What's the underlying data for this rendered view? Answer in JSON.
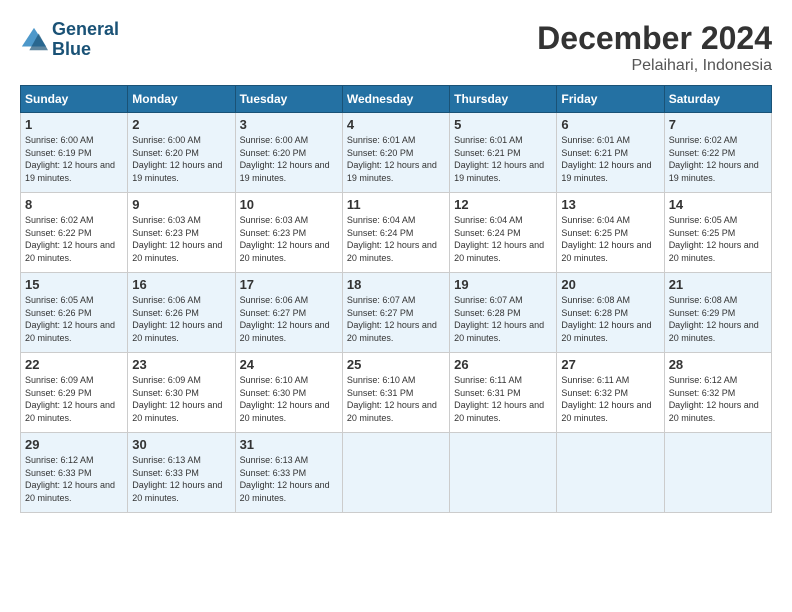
{
  "header": {
    "logo_line1": "General",
    "logo_line2": "Blue",
    "month_title": "December 2024",
    "location": "Pelaihari, Indonesia"
  },
  "weekdays": [
    "Sunday",
    "Monday",
    "Tuesday",
    "Wednesday",
    "Thursday",
    "Friday",
    "Saturday"
  ],
  "weeks": [
    [
      {
        "day": "1",
        "sunrise": "6:00 AM",
        "sunset": "6:19 PM",
        "daylight": "12 hours and 19 minutes."
      },
      {
        "day": "2",
        "sunrise": "6:00 AM",
        "sunset": "6:20 PM",
        "daylight": "12 hours and 19 minutes."
      },
      {
        "day": "3",
        "sunrise": "6:00 AM",
        "sunset": "6:20 PM",
        "daylight": "12 hours and 19 minutes."
      },
      {
        "day": "4",
        "sunrise": "6:01 AM",
        "sunset": "6:20 PM",
        "daylight": "12 hours and 19 minutes."
      },
      {
        "day": "5",
        "sunrise": "6:01 AM",
        "sunset": "6:21 PM",
        "daylight": "12 hours and 19 minutes."
      },
      {
        "day": "6",
        "sunrise": "6:01 AM",
        "sunset": "6:21 PM",
        "daylight": "12 hours and 19 minutes."
      },
      {
        "day": "7",
        "sunrise": "6:02 AM",
        "sunset": "6:22 PM",
        "daylight": "12 hours and 19 minutes."
      }
    ],
    [
      {
        "day": "8",
        "sunrise": "6:02 AM",
        "sunset": "6:22 PM",
        "daylight": "12 hours and 20 minutes."
      },
      {
        "day": "9",
        "sunrise": "6:03 AM",
        "sunset": "6:23 PM",
        "daylight": "12 hours and 20 minutes."
      },
      {
        "day": "10",
        "sunrise": "6:03 AM",
        "sunset": "6:23 PM",
        "daylight": "12 hours and 20 minutes."
      },
      {
        "day": "11",
        "sunrise": "6:04 AM",
        "sunset": "6:24 PM",
        "daylight": "12 hours and 20 minutes."
      },
      {
        "day": "12",
        "sunrise": "6:04 AM",
        "sunset": "6:24 PM",
        "daylight": "12 hours and 20 minutes."
      },
      {
        "day": "13",
        "sunrise": "6:04 AM",
        "sunset": "6:25 PM",
        "daylight": "12 hours and 20 minutes."
      },
      {
        "day": "14",
        "sunrise": "6:05 AM",
        "sunset": "6:25 PM",
        "daylight": "12 hours and 20 minutes."
      }
    ],
    [
      {
        "day": "15",
        "sunrise": "6:05 AM",
        "sunset": "6:26 PM",
        "daylight": "12 hours and 20 minutes."
      },
      {
        "day": "16",
        "sunrise": "6:06 AM",
        "sunset": "6:26 PM",
        "daylight": "12 hours and 20 minutes."
      },
      {
        "day": "17",
        "sunrise": "6:06 AM",
        "sunset": "6:27 PM",
        "daylight": "12 hours and 20 minutes."
      },
      {
        "day": "18",
        "sunrise": "6:07 AM",
        "sunset": "6:27 PM",
        "daylight": "12 hours and 20 minutes."
      },
      {
        "day": "19",
        "sunrise": "6:07 AM",
        "sunset": "6:28 PM",
        "daylight": "12 hours and 20 minutes."
      },
      {
        "day": "20",
        "sunrise": "6:08 AM",
        "sunset": "6:28 PM",
        "daylight": "12 hours and 20 minutes."
      },
      {
        "day": "21",
        "sunrise": "6:08 AM",
        "sunset": "6:29 PM",
        "daylight": "12 hours and 20 minutes."
      }
    ],
    [
      {
        "day": "22",
        "sunrise": "6:09 AM",
        "sunset": "6:29 PM",
        "daylight": "12 hours and 20 minutes."
      },
      {
        "day": "23",
        "sunrise": "6:09 AM",
        "sunset": "6:30 PM",
        "daylight": "12 hours and 20 minutes."
      },
      {
        "day": "24",
        "sunrise": "6:10 AM",
        "sunset": "6:30 PM",
        "daylight": "12 hours and 20 minutes."
      },
      {
        "day": "25",
        "sunrise": "6:10 AM",
        "sunset": "6:31 PM",
        "daylight": "12 hours and 20 minutes."
      },
      {
        "day": "26",
        "sunrise": "6:11 AM",
        "sunset": "6:31 PM",
        "daylight": "12 hours and 20 minutes."
      },
      {
        "day": "27",
        "sunrise": "6:11 AM",
        "sunset": "6:32 PM",
        "daylight": "12 hours and 20 minutes."
      },
      {
        "day": "28",
        "sunrise": "6:12 AM",
        "sunset": "6:32 PM",
        "daylight": "12 hours and 20 minutes."
      }
    ],
    [
      {
        "day": "29",
        "sunrise": "6:12 AM",
        "sunset": "6:33 PM",
        "daylight": "12 hours and 20 minutes."
      },
      {
        "day": "30",
        "sunrise": "6:13 AM",
        "sunset": "6:33 PM",
        "daylight": "12 hours and 20 minutes."
      },
      {
        "day": "31",
        "sunrise": "6:13 AM",
        "sunset": "6:33 PM",
        "daylight": "12 hours and 20 minutes."
      },
      null,
      null,
      null,
      null
    ]
  ]
}
